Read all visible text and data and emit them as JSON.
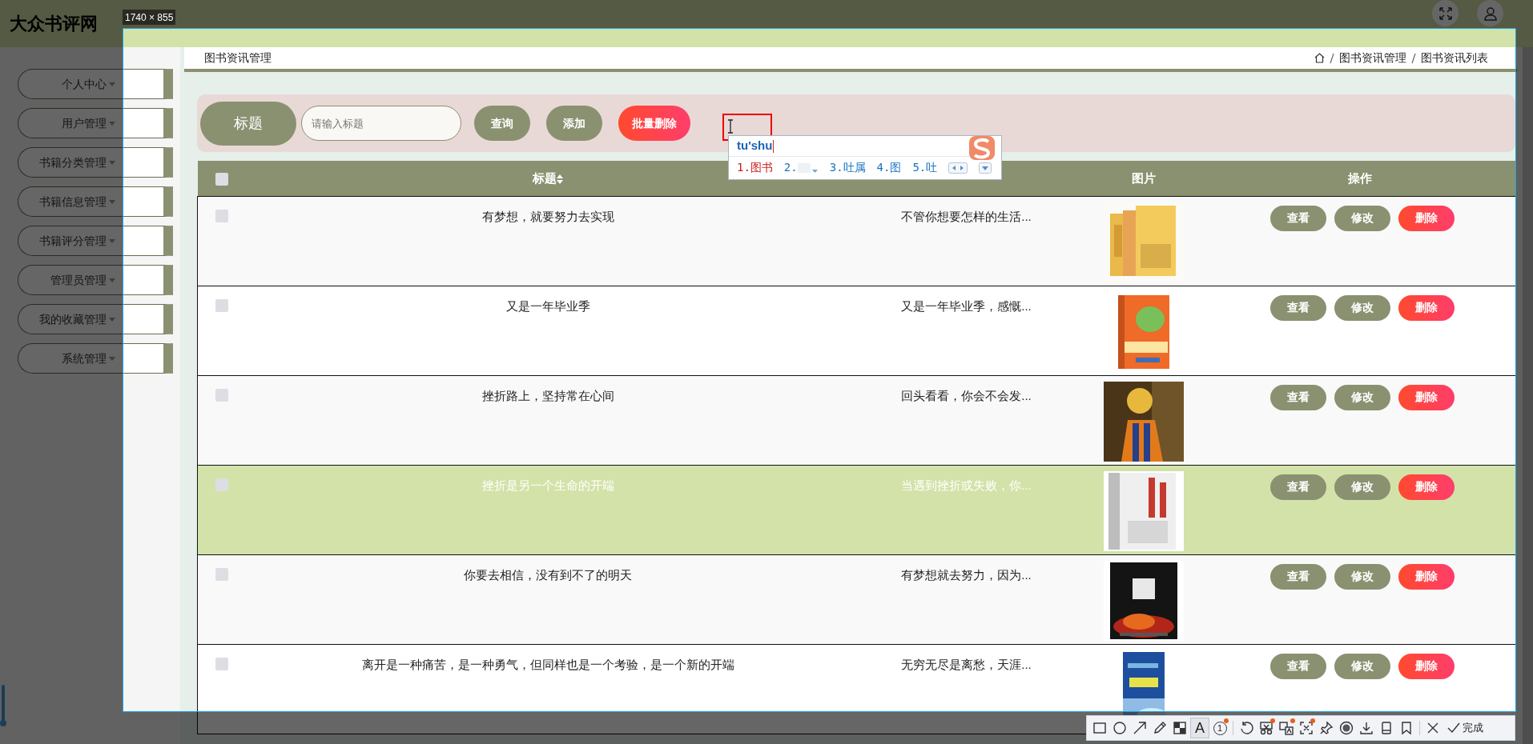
{
  "header": {
    "logo": "大众书评网"
  },
  "sidebar": {
    "items": [
      {
        "label": "个人中心"
      },
      {
        "label": "用户管理"
      },
      {
        "label": "书籍分类管理"
      },
      {
        "label": "书籍信息管理"
      },
      {
        "label": "书籍评分管理"
      },
      {
        "label": "管理员管理"
      },
      {
        "label": "我的收藏管理"
      },
      {
        "label": "系统管理"
      }
    ]
  },
  "breadcrumb": {
    "page_title": "图书资讯管理",
    "trail": [
      "图书资讯管理",
      "图书资讯列表"
    ]
  },
  "search": {
    "label": "标题",
    "placeholder": "请输入标题",
    "buttons": [
      {
        "label": "查询",
        "kind": "normal"
      },
      {
        "label": "添加",
        "kind": "normal"
      },
      {
        "label": "批量删除",
        "kind": "danger"
      }
    ]
  },
  "table": {
    "columns": [
      {
        "kind": "check",
        "checked": false
      },
      {
        "kind": "text",
        "label": "标题",
        "sortable": true
      },
      {
        "kind": "blank"
      },
      {
        "kind": "text",
        "label": "图片",
        "sortable": false
      },
      {
        "kind": "text",
        "label": "操作",
        "sortable": false
      }
    ],
    "rows": [
      {
        "title": "有梦想，就要努力去实现",
        "intro": "不管你想要怎样的生活...",
        "selected": false,
        "checked": false,
        "actions": [
          {
            "label": "查看",
            "kind": "view"
          },
          {
            "label": "修改",
            "kind": "edit"
          },
          {
            "label": "删除",
            "kind": "delete"
          }
        ]
      },
      {
        "title": "又是一年毕业季",
        "intro": "又是一年毕业季，感慨...",
        "selected": false,
        "checked": false,
        "actions": [
          {
            "label": "查看",
            "kind": "view"
          },
          {
            "label": "修改",
            "kind": "edit"
          },
          {
            "label": "删除",
            "kind": "delete"
          }
        ]
      },
      {
        "title": "挫折路上，坚持常在心间",
        "intro": "回头看看，你会不会发...",
        "selected": false,
        "checked": false,
        "actions": [
          {
            "label": "查看",
            "kind": "view"
          },
          {
            "label": "修改",
            "kind": "edit"
          },
          {
            "label": "删除",
            "kind": "delete"
          }
        ]
      },
      {
        "title": "挫折是另一个生命的开端",
        "intro": "当遇到挫折或失败，你...",
        "selected": true,
        "checked": false,
        "actions": [
          {
            "label": "查看",
            "kind": "view"
          },
          {
            "label": "修改",
            "kind": "edit"
          },
          {
            "label": "删除",
            "kind": "delete"
          }
        ]
      },
      {
        "title": "你要去相信，没有到不了的明天",
        "intro": "有梦想就去努力，因为...",
        "selected": false,
        "checked": false,
        "actions": [
          {
            "label": "查看",
            "kind": "view"
          },
          {
            "label": "修改",
            "kind": "edit"
          },
          {
            "label": "删除",
            "kind": "delete"
          }
        ]
      },
      {
        "title": "离开是一种痛苦，是一种勇气，但同样也是一个考验，是一个新的开端",
        "intro": "无穷无尽是离愁，天涯...",
        "selected": false,
        "checked": false,
        "actions": [
          {
            "label": "查看",
            "kind": "view"
          },
          {
            "label": "修改",
            "kind": "edit"
          },
          {
            "label": "删除",
            "kind": "delete"
          }
        ]
      }
    ]
  },
  "ime": {
    "composition": "tu'shu",
    "candidates": [
      {
        "label": "1.图书",
        "selected": true
      },
      {
        "label": "2.",
        "selected": false
      },
      {
        "label": "3.吐属",
        "selected": false
      },
      {
        "label": "4.图",
        "selected": false
      },
      {
        "label": "5.吐",
        "selected": false
      }
    ]
  },
  "screenshot_tool": {
    "size_label": "1740 × 855",
    "toolbar": [
      {
        "kind": "rect",
        "selected": false,
        "dot": false
      },
      {
        "kind": "ellipse",
        "selected": false,
        "dot": false
      },
      {
        "kind": "arrow",
        "selected": false,
        "dot": false
      },
      {
        "kind": "pencil",
        "selected": false,
        "dot": false
      },
      {
        "kind": "mosaic",
        "selected": false,
        "dot": false
      },
      {
        "kind": "text",
        "label": "A",
        "selected": true,
        "dot": false
      },
      {
        "kind": "number",
        "label": "1",
        "selected": false,
        "dot": true
      },
      {
        "kind": "separator"
      },
      {
        "kind": "undo",
        "selected": false,
        "dot": false
      },
      {
        "kind": "cutout",
        "selected": false,
        "dot": true
      },
      {
        "kind": "translate",
        "selected": false,
        "dot": true
      },
      {
        "kind": "ocr",
        "selected": false,
        "dot": true
      },
      {
        "kind": "pin",
        "selected": false,
        "dot": false
      },
      {
        "kind": "record",
        "selected": false,
        "dot": false
      },
      {
        "kind": "download",
        "selected": false,
        "dot": false
      },
      {
        "kind": "phone",
        "selected": false,
        "dot": false
      },
      {
        "kind": "bookmark",
        "selected": false,
        "dot": false
      },
      {
        "kind": "separator"
      },
      {
        "kind": "close",
        "selected": false,
        "dot": false
      },
      {
        "kind": "done",
        "label": "完成",
        "selected": false,
        "dot": false
      }
    ]
  }
}
